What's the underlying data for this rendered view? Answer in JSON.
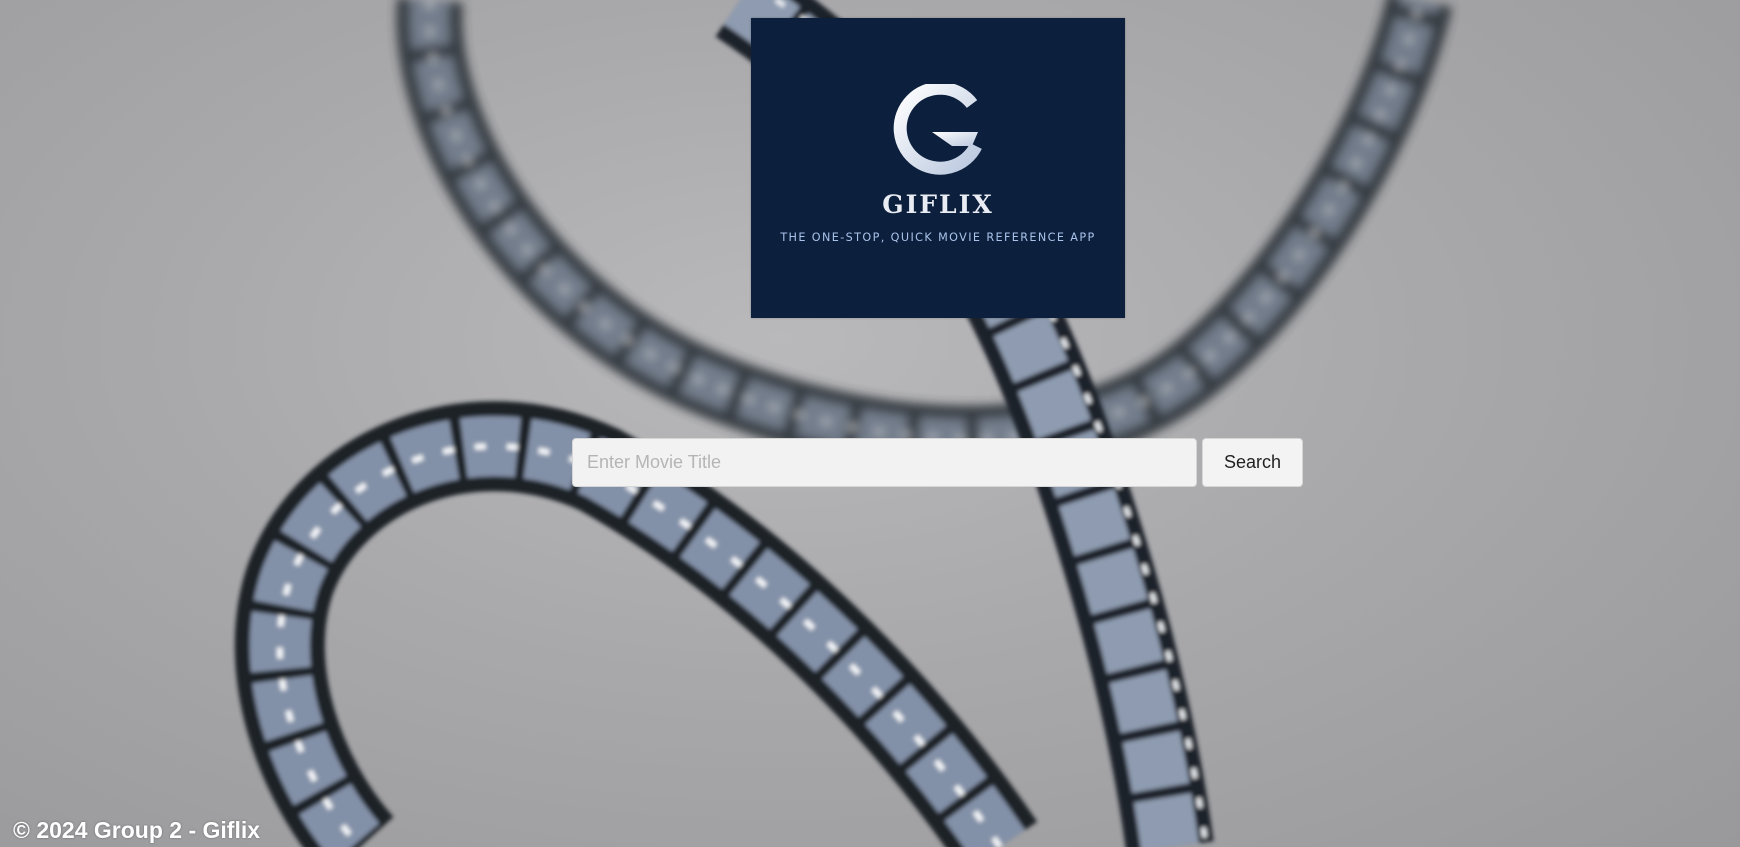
{
  "logo": {
    "name": "GIFLIX",
    "tagline": "THE ONE-STOP, QUICK MOVIE REFERENCE APP",
    "icon": "giflix-g-logo-icon",
    "background_color": "#0c1f3d"
  },
  "search": {
    "placeholder": "Enter Movie Title",
    "value": "",
    "button_label": "Search"
  },
  "footer": {
    "text": "© 2024 Group 2 - Giflix"
  },
  "background": {
    "image": "film-reel-strip-background"
  }
}
